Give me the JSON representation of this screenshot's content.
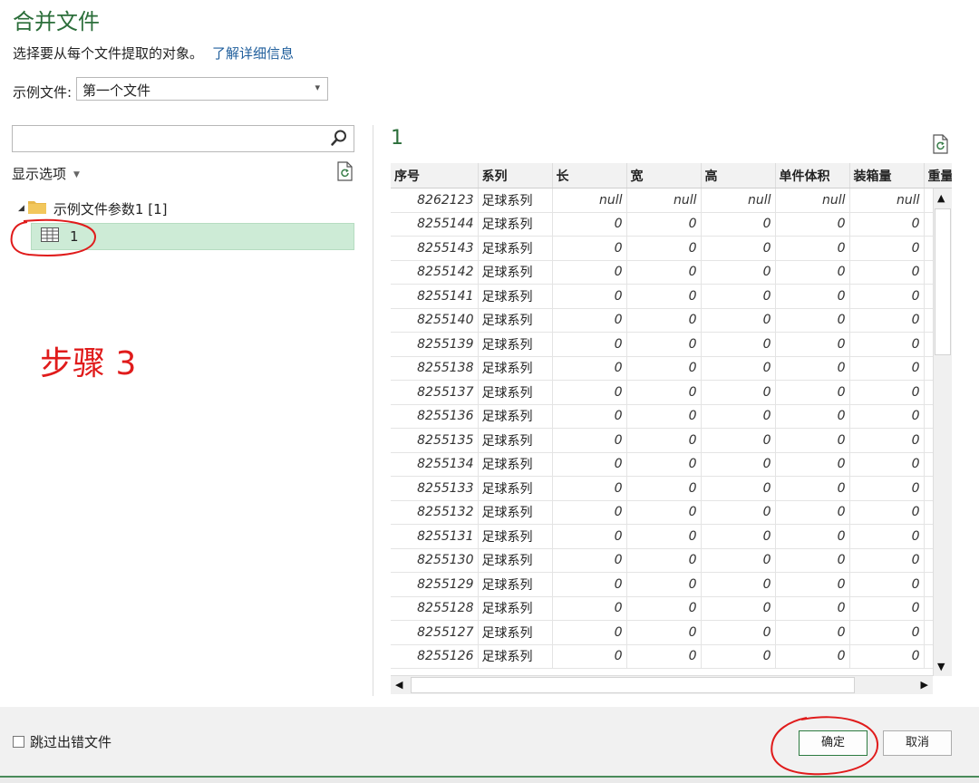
{
  "dialog": {
    "title": "合并文件",
    "instruction": "选择要从每个文件提取的对象。",
    "learn_more": "了解详细信息",
    "sample_label": "示例文件:",
    "sample_value": "第一个文件",
    "search_placeholder": ""
  },
  "navigator": {
    "display_options": "显示选项",
    "folder_label": "示例文件参数1 [1]",
    "item_label": "1"
  },
  "annotation": {
    "step_text": "步骤 3",
    "color": "#e01b1b"
  },
  "preview": {
    "title": "1",
    "columns": [
      "序号",
      "系列",
      "长",
      "宽",
      "高",
      "单件体积",
      "装箱量",
      "重量"
    ],
    "rows": [
      [
        "8262123",
        "足球系列",
        "null",
        "null",
        "null",
        "null",
        "null"
      ],
      [
        "8255144",
        "足球系列",
        "0",
        "0",
        "0",
        "0",
        "0"
      ],
      [
        "8255143",
        "足球系列",
        "0",
        "0",
        "0",
        "0",
        "0"
      ],
      [
        "8255142",
        "足球系列",
        "0",
        "0",
        "0",
        "0",
        "0"
      ],
      [
        "8255141",
        "足球系列",
        "0",
        "0",
        "0",
        "0",
        "0"
      ],
      [
        "8255140",
        "足球系列",
        "0",
        "0",
        "0",
        "0",
        "0"
      ],
      [
        "8255139",
        "足球系列",
        "0",
        "0",
        "0",
        "0",
        "0"
      ],
      [
        "8255138",
        "足球系列",
        "0",
        "0",
        "0",
        "0",
        "0"
      ],
      [
        "8255137",
        "足球系列",
        "0",
        "0",
        "0",
        "0",
        "0"
      ],
      [
        "8255136",
        "足球系列",
        "0",
        "0",
        "0",
        "0",
        "0"
      ],
      [
        "8255135",
        "足球系列",
        "0",
        "0",
        "0",
        "0",
        "0"
      ],
      [
        "8255134",
        "足球系列",
        "0",
        "0",
        "0",
        "0",
        "0"
      ],
      [
        "8255133",
        "足球系列",
        "0",
        "0",
        "0",
        "0",
        "0"
      ],
      [
        "8255132",
        "足球系列",
        "0",
        "0",
        "0",
        "0",
        "0"
      ],
      [
        "8255131",
        "足球系列",
        "0",
        "0",
        "0",
        "0",
        "0"
      ],
      [
        "8255130",
        "足球系列",
        "0",
        "0",
        "0",
        "0",
        "0"
      ],
      [
        "8255129",
        "足球系列",
        "0",
        "0",
        "0",
        "0",
        "0"
      ],
      [
        "8255128",
        "足球系列",
        "0",
        "0",
        "0",
        "0",
        "0"
      ],
      [
        "8255127",
        "足球系列",
        "0",
        "0",
        "0",
        "0",
        "0"
      ],
      [
        "8255126",
        "足球系列",
        "0",
        "0",
        "0",
        "0",
        "0"
      ]
    ]
  },
  "footer": {
    "skip_errors_label": "跳过出错文件",
    "ok_label": "确定",
    "cancel_label": "取消"
  },
  "colors": {
    "accent_green": "#2b6e3a",
    "selection": "#cdebd6",
    "link": "#1f5e9c"
  },
  "icons": [
    "search-icon",
    "refresh-icon",
    "folder-icon",
    "table-icon",
    "chevron-down-icon"
  ]
}
